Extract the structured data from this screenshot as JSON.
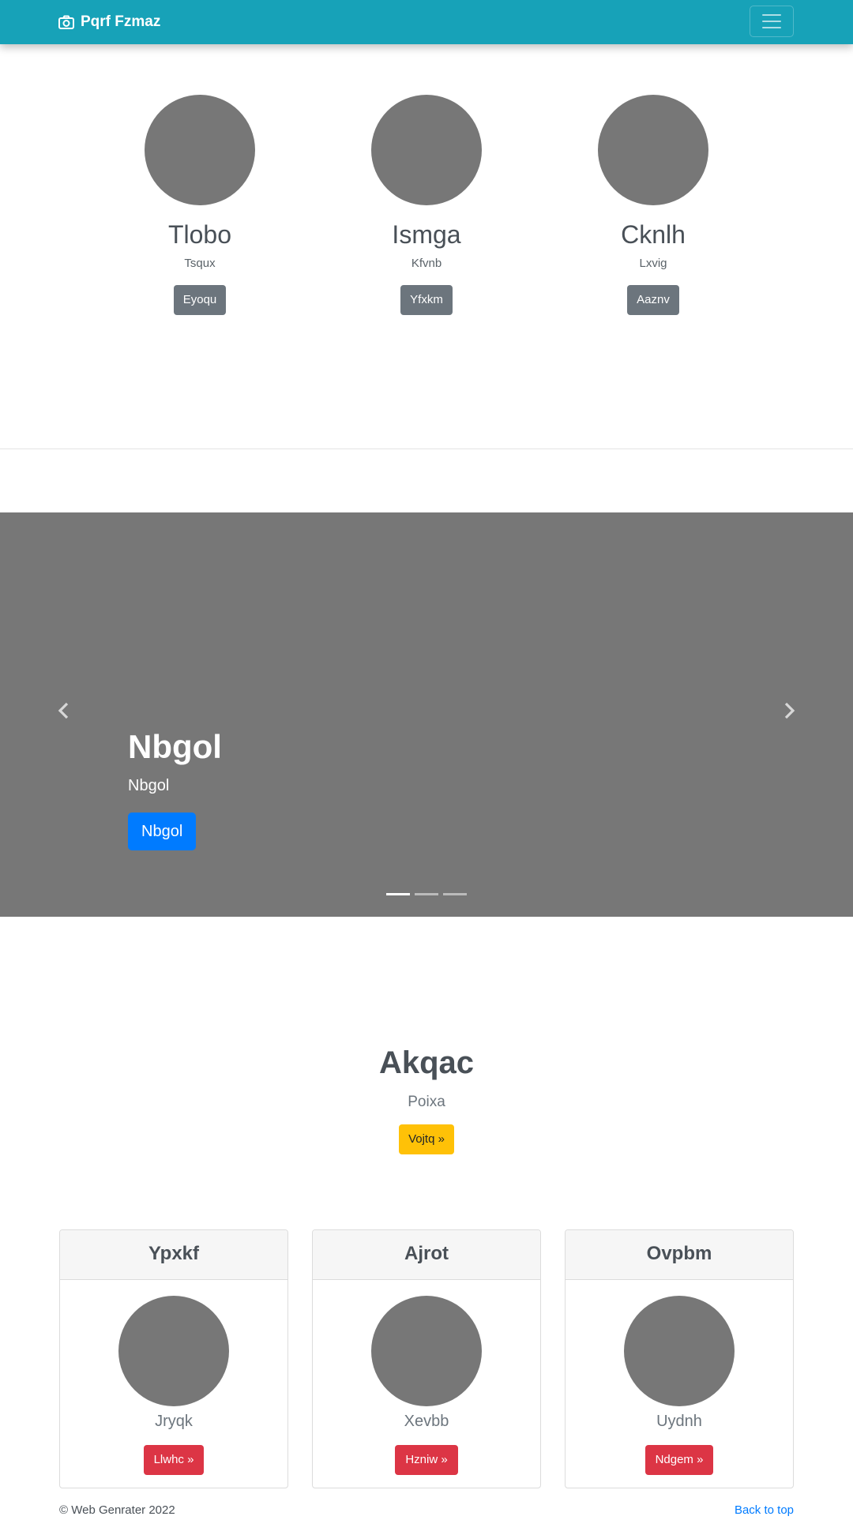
{
  "navbar": {
    "brand": "Pqrf Fzmaz",
    "brand_icon": "camera-icon",
    "toggler_icon": "hamburger-icon",
    "color": "#17a2b8"
  },
  "team": [
    {
      "name": "Tlobo",
      "role": "Tsqux",
      "button": "Eyoqu"
    },
    {
      "name": "Ismga",
      "role": "Kfvnb",
      "button": "Yfxkm"
    },
    {
      "name": "Cknlh",
      "role": "Lxvig",
      "button": "Aaznv"
    }
  ],
  "carousel": {
    "title": "Nbgol",
    "subtitle": "Nbgol",
    "button": "Nbgol",
    "prev_icon": "chevron-left-icon",
    "next_icon": "chevron-right-icon",
    "slide_count": 3,
    "active_slide": 1
  },
  "feature": {
    "title": "Akqac",
    "subtitle": "Poixa",
    "button": "Vojtq »"
  },
  "cards": [
    {
      "header": "Ypxkf",
      "subtitle": "Jryqk",
      "button": "Llwhc »"
    },
    {
      "header": "Ajrot",
      "subtitle": "Xevbb",
      "button": "Hzniw »"
    },
    {
      "header": "Ovpbm",
      "subtitle": "Uydnh",
      "button": "Ndgem »"
    }
  ],
  "footer": {
    "copyright": "© Web Genrater 2022",
    "back_to_top": "Back to top"
  }
}
